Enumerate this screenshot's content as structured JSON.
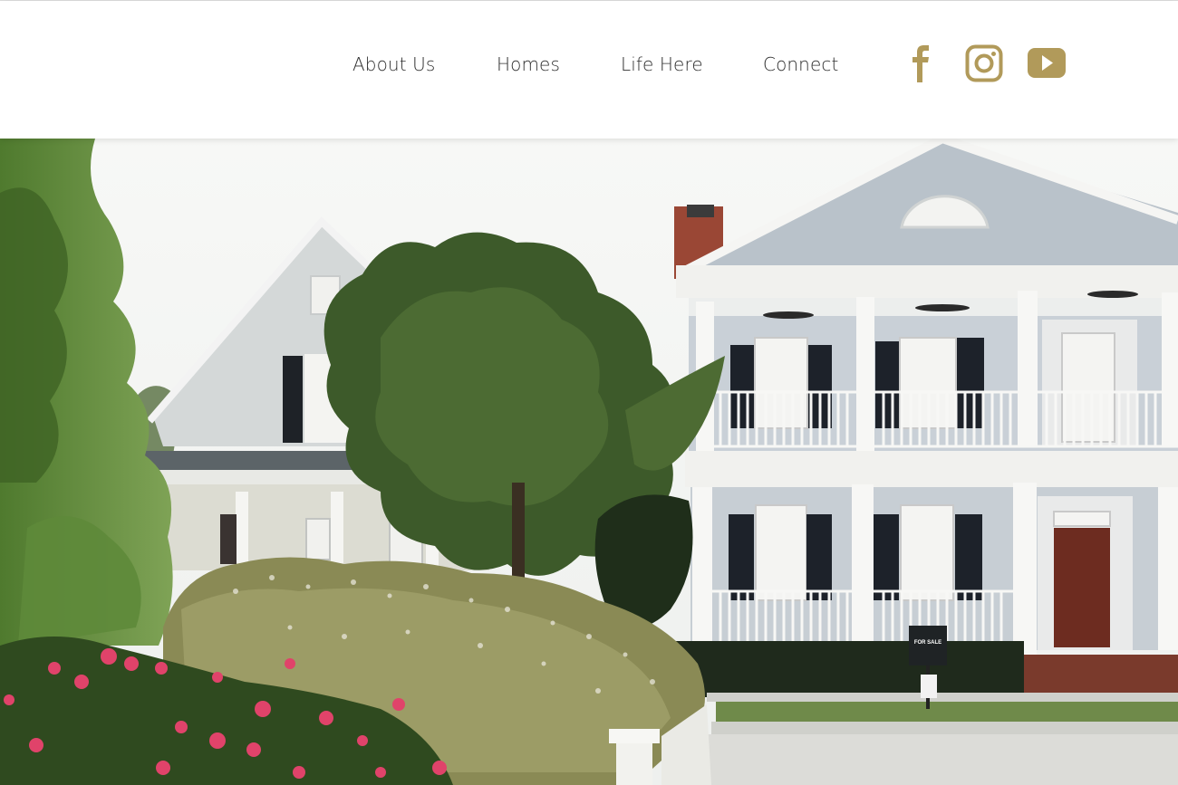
{
  "header": {
    "nav": [
      {
        "label": "About Us"
      },
      {
        "label": "Homes"
      },
      {
        "label": "Life Here"
      },
      {
        "label": "Connect"
      }
    ],
    "social": [
      {
        "icon": "facebook-icon",
        "label": "Facebook"
      },
      {
        "icon": "instagram-icon",
        "label": "Instagram"
      },
      {
        "icon": "youtube-icon",
        "label": "YouTube"
      }
    ],
    "accent_color": "#b19a5a"
  },
  "hero": {
    "description": "Two white colonial-style homes with double porches behind a flowering hedge",
    "sign_text": "FOR SALE"
  }
}
